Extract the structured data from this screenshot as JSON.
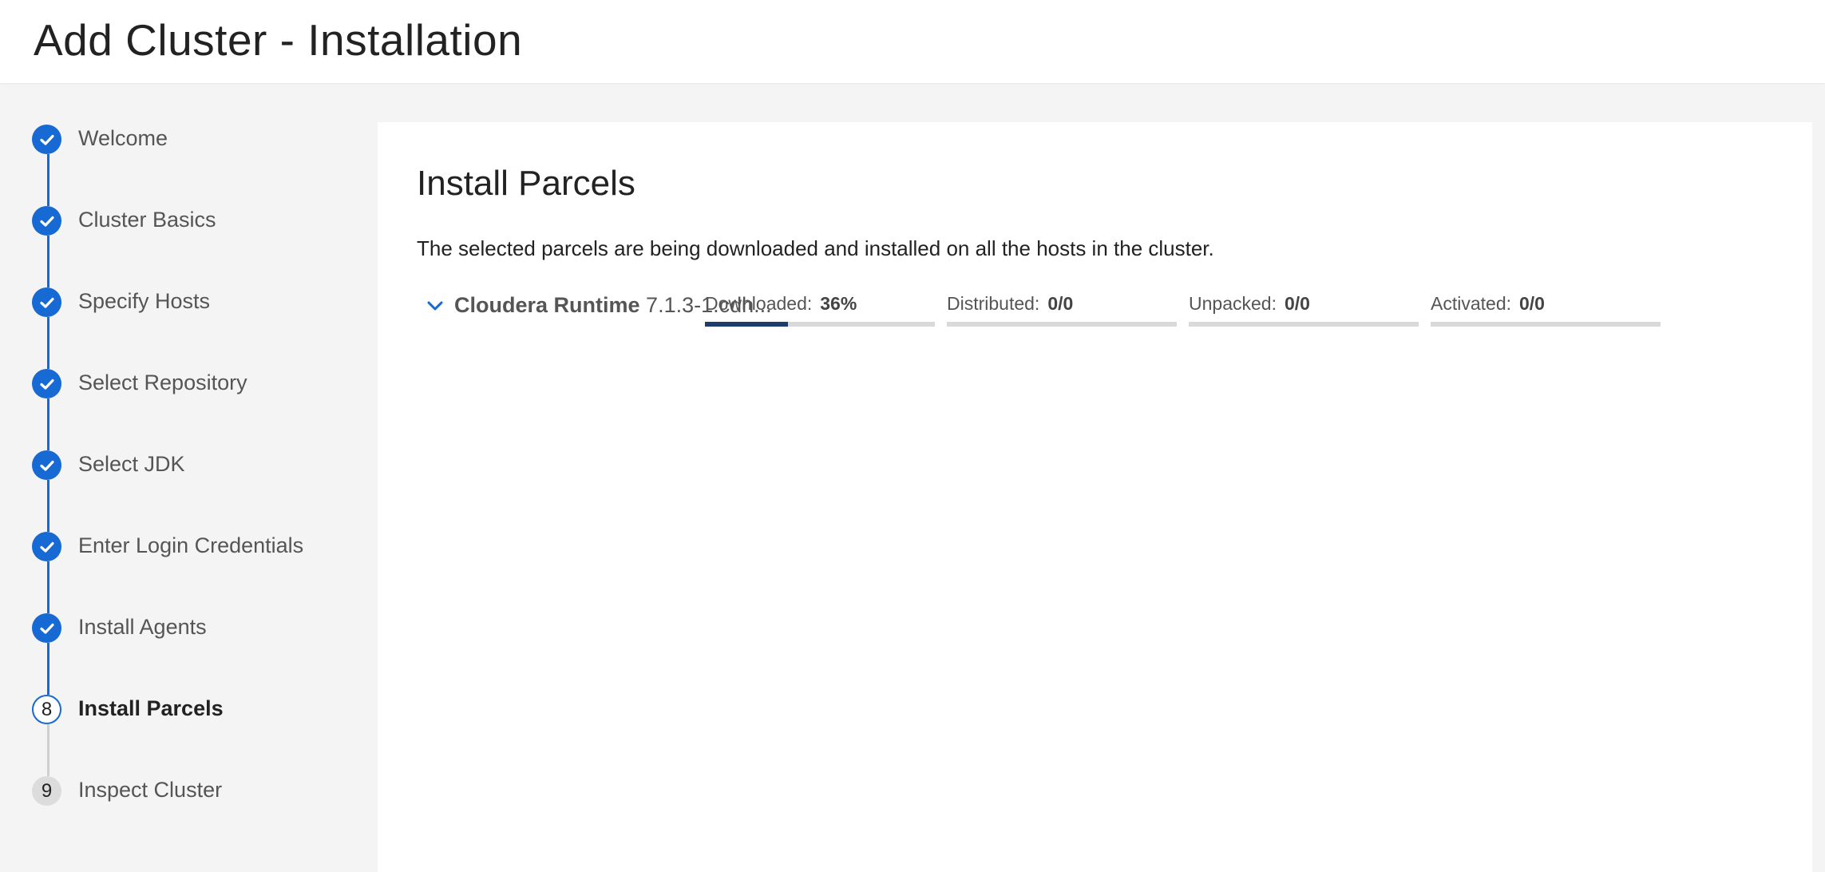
{
  "header": {
    "title": "Add Cluster - Installation"
  },
  "steps": [
    {
      "label": "Welcome",
      "status": "done"
    },
    {
      "label": "Cluster Basics",
      "status": "done"
    },
    {
      "label": "Specify Hosts",
      "status": "done"
    },
    {
      "label": "Select Repository",
      "status": "done"
    },
    {
      "label": "Select JDK",
      "status": "done"
    },
    {
      "label": "Enter Login Credentials",
      "status": "done"
    },
    {
      "label": "Install Agents",
      "status": "done"
    },
    {
      "label": "Install Parcels",
      "status": "current",
      "number": "8"
    },
    {
      "label": "Inspect Cluster",
      "status": "pending",
      "number": "9"
    }
  ],
  "main": {
    "title": "Install Parcels",
    "description": "The selected parcels are being downloaded and installed on all the hosts in the cluster.",
    "parcel": {
      "name": "Cloudera Runtime",
      "version": "7.1.3-1.cdh...",
      "expand_icon": "chevron-down-icon",
      "stats": [
        {
          "label": "Downloaded:",
          "value": "36%",
          "progress": 0.36
        },
        {
          "label": "Distributed:",
          "value": "0/0",
          "progress": 0
        },
        {
          "label": "Unpacked:",
          "value": "0/0",
          "progress": 0
        },
        {
          "label": "Activated:",
          "value": "0/0",
          "progress": 0
        }
      ]
    }
  },
  "colors": {
    "accent": "#1769d4",
    "progress_fill": "#1f3d6b",
    "progress_track": "#d9d9d9",
    "line_done": "#1769d4",
    "line_pending": "#cfcfcf"
  }
}
